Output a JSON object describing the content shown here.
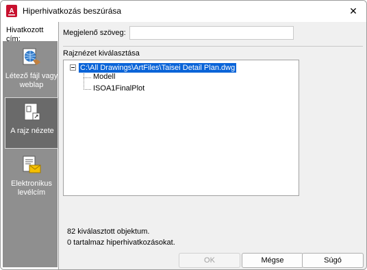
{
  "window": {
    "title": "Hiperhivatkozás beszúrása",
    "close_glyph": "✕"
  },
  "sidebar": {
    "heading": "Hivatkozott cím:",
    "items": [
      {
        "label": "Létező fájl vagy weblap",
        "icon": "file-web-icon",
        "selected": false
      },
      {
        "label": "A rajz nézete",
        "icon": "drawing-view-icon",
        "selected": true
      },
      {
        "label": "Elektronikus levélcím",
        "icon": "email-icon",
        "selected": false
      }
    ]
  },
  "form": {
    "display_text_label": "Megjelenő szöveg:",
    "display_text_value": "",
    "tree_label": "Rajznézet kiválasztása",
    "tree": {
      "root": "C:\\All Drawings\\ArtFiles\\Taisei Detail Plan.dwg",
      "children": [
        "Modell",
        "ISOA1FinalPlot"
      ]
    }
  },
  "status": {
    "line1": "82 kiválasztott objektum.",
    "line2": "0 tartalmaz hiperhivatkozásokat."
  },
  "buttons": {
    "ok": "OK",
    "cancel": "Mégse",
    "help": "Súgó"
  },
  "colors": {
    "selection": "#0a64d8",
    "sidebar_bg": "#8f8f8f",
    "app_icon": "#c8102e"
  }
}
